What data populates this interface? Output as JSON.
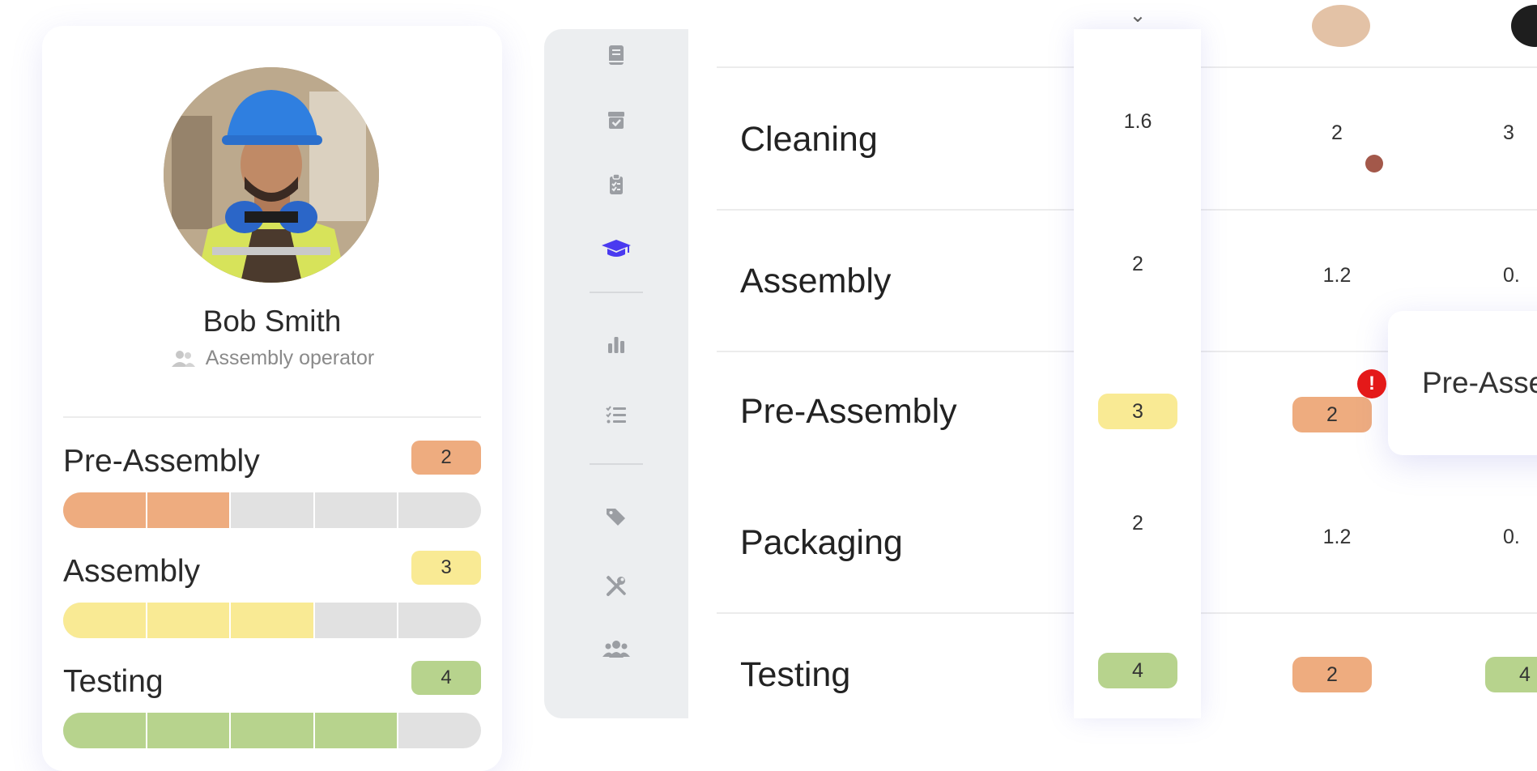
{
  "profile": {
    "name": "Bob Smith",
    "role": "Assembly operator",
    "skills": [
      {
        "name": "Pre-Assembly",
        "level": 2,
        "max": 5,
        "color": "#eeac7f"
      },
      {
        "name": "Assembly",
        "level": 3,
        "max": 5,
        "color": "#f9ea94"
      },
      {
        "name": "Testing",
        "level": 4,
        "max": 5,
        "color": "#b7d38d"
      }
    ]
  },
  "sidebar": {
    "items": [
      {
        "icon": "book-icon",
        "active": false
      },
      {
        "icon": "box-check-icon",
        "active": false
      },
      {
        "icon": "clipboard-check-icon",
        "active": false
      },
      {
        "icon": "graduation-cap-icon",
        "active": true
      },
      {
        "icon": "bar-chart-icon",
        "active": false
      },
      {
        "icon": "task-list-icon",
        "active": false
      },
      {
        "icon": "tags-icon",
        "active": false
      },
      {
        "icon": "tools-icon",
        "active": false
      },
      {
        "icon": "users-icon",
        "active": false
      }
    ],
    "active_color": "#4a3af0",
    "icon_color": "#9b9ea3"
  },
  "table": {
    "rows": [
      {
        "label": "Cleaning",
        "focus": "1.6",
        "col2": "2",
        "col3": "3"
      },
      {
        "label": "Assembly",
        "focus": "2",
        "col2": "1.2",
        "col3": "0."
      },
      {
        "label": "Pre-Assembly",
        "focus": "3",
        "col2": "2",
        "col3": ""
      },
      {
        "label": "Packaging",
        "focus": "2",
        "col2": "1.2",
        "col3": "0."
      },
      {
        "label": "Testing",
        "focus": "4",
        "col2": "2",
        "col3": "4"
      }
    ],
    "tooltip_text": "Pre-Asse",
    "alert_symbol": "!"
  }
}
